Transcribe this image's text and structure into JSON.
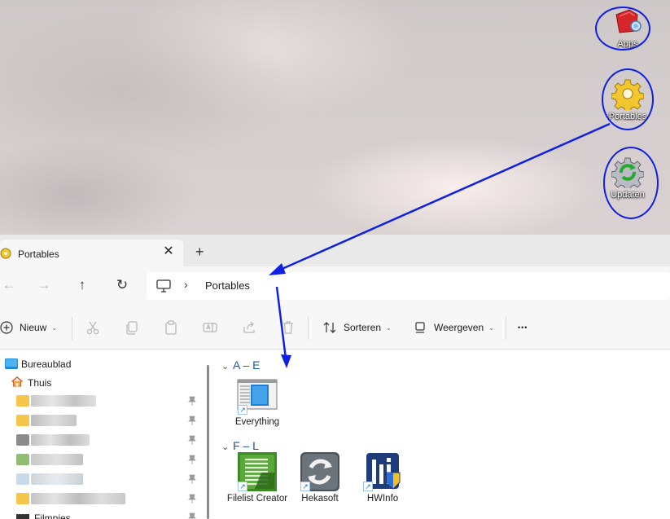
{
  "desktop": {
    "icons": [
      {
        "label": "Apps",
        "icon": "red-bag-icon"
      },
      {
        "label": "Portables",
        "icon": "gear-icon"
      },
      {
        "label": "Updaten",
        "icon": "refresh-gear-icon"
      }
    ]
  },
  "window": {
    "tab_title": "Portables",
    "tab_close": "✕",
    "new_tab": "+",
    "nav": {
      "back": "←",
      "forward": "→",
      "up": "↑",
      "refresh": "↻"
    },
    "address": {
      "separator": "›",
      "crumb": "Portables"
    },
    "toolbar": {
      "new_label": "Nieuw",
      "sort_label": "Sorteren",
      "view_label": "Weergeven",
      "more": "•••",
      "chevron": "⌄"
    },
    "sidebar": {
      "items": [
        {
          "label": "Bureaublad",
          "icon": "desktop-folder-icon"
        },
        {
          "label": "Thuis",
          "icon": "home-icon"
        },
        {
          "label": "Filmpjes",
          "icon": "film-icon"
        }
      ]
    },
    "groups": [
      {
        "header": "A – E",
        "files": [
          {
            "label": "Everything"
          }
        ]
      },
      {
        "header": "F – L",
        "files": [
          {
            "label": "Filelist Creator"
          },
          {
            "label": "Hekasoft"
          },
          {
            "label": "HWInfo"
          }
        ]
      }
    ]
  },
  "colors": {
    "annotation": "#1020e0",
    "accent": "#1a55a8"
  }
}
